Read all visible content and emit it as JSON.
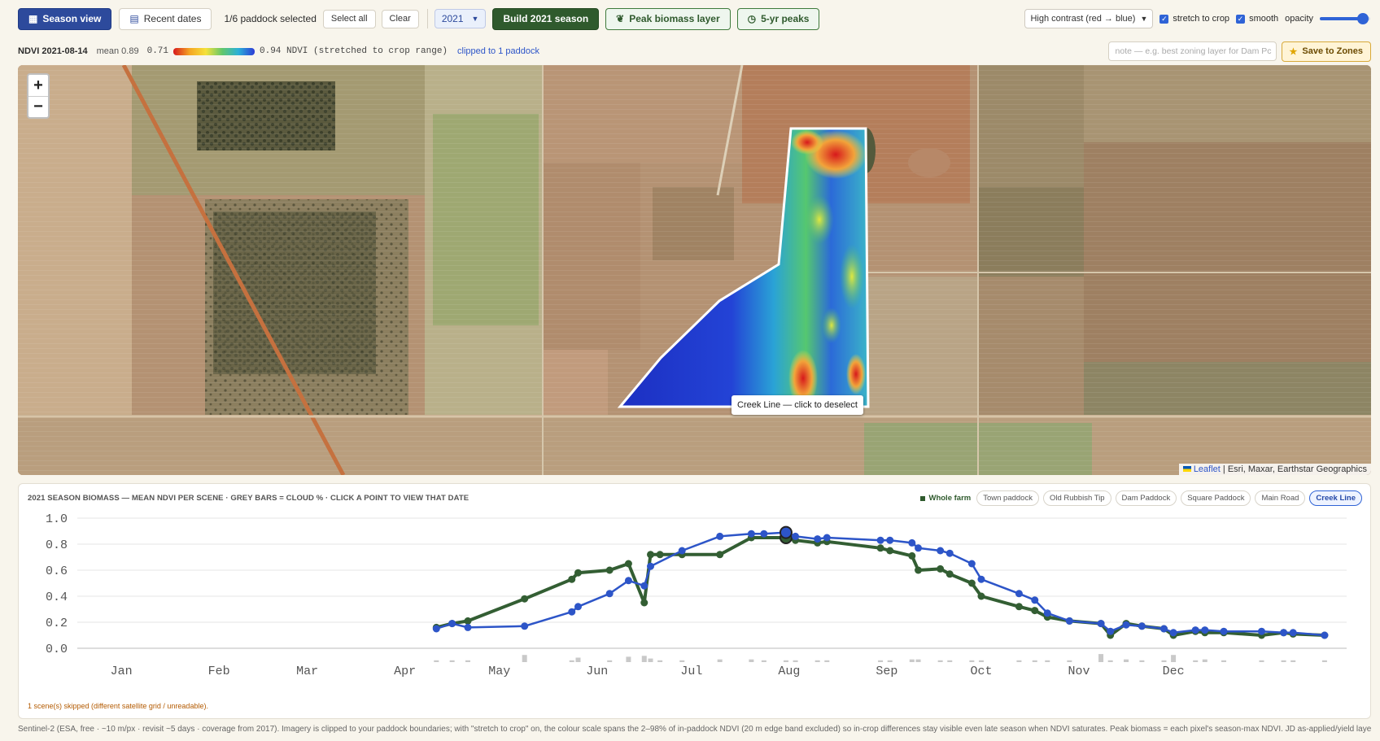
{
  "toolbar": {
    "season_view": "Season view",
    "recent_dates": "Recent dates",
    "paddock_selected": "1/6 paddock selected",
    "select_all": "Select all",
    "clear": "Clear",
    "year": "2021",
    "build_season": "Build 2021 season",
    "peak_biomass": "Peak biomass layer",
    "five_yr_peaks": "5-yr peaks",
    "palette": "High contrast (red → blue)",
    "stretch_label": "stretch to crop",
    "smooth_label": "smooth",
    "opacity_label": "opacity",
    "opacity_value": 0.85
  },
  "info": {
    "date": "NDVI 2021-08-14",
    "mean": "mean 0.89",
    "scale_min": "0.71",
    "scale_max": "0.94 NDVI (stretched to crop range)",
    "clipped": "clipped to 1 paddock",
    "note_placeholder": "note — e.g. best zoning layer for Dam Pc",
    "save_zones": "Save to Zones"
  },
  "map": {
    "tooltip": "Creek Line — click to deselect",
    "attribution_leaflet": "Leaflet",
    "attribution_rest": " | Esri, Maxar, Earthstar Geographics"
  },
  "chart_panel": {
    "title": "2021 SEASON BIOMASS — MEAN NDVI PER SCENE · GREY BARS = CLOUD % · CLICK A POINT TO VIEW THAT DATE",
    "legend": [
      "Whole farm",
      "Town paddock",
      "Old Rubbish Tip",
      "Dam Paddock",
      "Square Paddock",
      "Main Road",
      "Creek Line"
    ],
    "skipped": "1 scene(s) skipped (different satellite grid / unreadable)."
  },
  "chart_data": {
    "type": "line",
    "title": "2021 SEASON BIOMASS — MEAN NDVI PER SCENE",
    "xlabel": "",
    "ylabel": "",
    "ylim": [
      0,
      1.0
    ],
    "yticks": [
      "0.0",
      "0.2",
      "0.4",
      "0.6",
      "0.8",
      "1.0"
    ],
    "xticks": [
      "Jan",
      "Feb",
      "Mar",
      "Apr",
      "May",
      "Jun",
      "Jul",
      "Aug",
      "Sep",
      "Oct",
      "Nov",
      "Dec"
    ],
    "series": [
      {
        "name": "Whole farm",
        "color": "#335e33",
        "points": [
          [
            "2021-04-25",
            0.16
          ],
          [
            "2021-04-30",
            0.19
          ],
          [
            "2021-05-05",
            0.21
          ],
          [
            "2021-05-23",
            0.38
          ],
          [
            "2021-06-07",
            0.53
          ],
          [
            "2021-06-09",
            0.58
          ],
          [
            "2021-06-19",
            0.6
          ],
          [
            "2021-06-25",
            0.65
          ],
          [
            "2021-06-30",
            0.35
          ],
          [
            "2021-07-02",
            0.72
          ],
          [
            "2021-07-05",
            0.72
          ],
          [
            "2021-07-12",
            0.72
          ],
          [
            "2021-07-24",
            0.72
          ],
          [
            "2021-08-03",
            0.85
          ],
          [
            "2021-08-14",
            0.85
          ],
          [
            "2021-08-17",
            0.83
          ],
          [
            "2021-08-24",
            0.81
          ],
          [
            "2021-08-27",
            0.82
          ],
          [
            "2021-09-13",
            0.77
          ],
          [
            "2021-09-16",
            0.75
          ],
          [
            "2021-09-23",
            0.71
          ],
          [
            "2021-09-25",
            0.6
          ],
          [
            "2021-10-02",
            0.61
          ],
          [
            "2021-10-05",
            0.57
          ],
          [
            "2021-10-12",
            0.5
          ],
          [
            "2021-10-15",
            0.4
          ],
          [
            "2021-10-27",
            0.32
          ],
          [
            "2021-11-01",
            0.29
          ],
          [
            "2021-11-05",
            0.24
          ],
          [
            "2021-11-12",
            0.21
          ],
          [
            "2021-11-22",
            0.19
          ],
          [
            "2021-11-25",
            0.1
          ],
          [
            "2021-11-30",
            0.19
          ],
          [
            "2021-12-05",
            0.17
          ],
          [
            "2021-12-12",
            0.15
          ],
          [
            "2021-12-15",
            0.1
          ],
          [
            "2021-12-22",
            0.13
          ],
          [
            "2021-12-25",
            0.12
          ],
          [
            "2021-12-31",
            0.12
          ],
          [
            "2022-01-12",
            0.1
          ],
          [
            "2022-01-19",
            0.12
          ],
          [
            "2022-01-22",
            0.11
          ],
          [
            "2022-02-01",
            0.1
          ]
        ]
      },
      {
        "name": "Creek Line",
        "color": "#2d55c8",
        "points": [
          [
            "2021-04-25",
            0.15
          ],
          [
            "2021-04-30",
            0.19
          ],
          [
            "2021-05-05",
            0.16
          ],
          [
            "2021-05-23",
            0.17
          ],
          [
            "2021-06-07",
            0.28
          ],
          [
            "2021-06-09",
            0.32
          ],
          [
            "2021-06-19",
            0.42
          ],
          [
            "2021-06-25",
            0.52
          ],
          [
            "2021-06-30",
            0.48
          ],
          [
            "2021-07-02",
            0.63
          ],
          [
            "2021-07-12",
            0.75
          ],
          [
            "2021-07-24",
            0.86
          ],
          [
            "2021-08-03",
            0.88
          ],
          [
            "2021-08-07",
            0.88
          ],
          [
            "2021-08-14",
            0.89
          ],
          [
            "2021-08-17",
            0.86
          ],
          [
            "2021-08-24",
            0.84
          ],
          [
            "2021-08-27",
            0.85
          ],
          [
            "2021-09-13",
            0.83
          ],
          [
            "2021-09-16",
            0.83
          ],
          [
            "2021-09-23",
            0.81
          ],
          [
            "2021-09-25",
            0.77
          ],
          [
            "2021-10-02",
            0.75
          ],
          [
            "2021-10-05",
            0.73
          ],
          [
            "2021-10-12",
            0.65
          ],
          [
            "2021-10-15",
            0.53
          ],
          [
            "2021-10-27",
            0.42
          ],
          [
            "2021-11-01",
            0.37
          ],
          [
            "2021-11-05",
            0.27
          ],
          [
            "2021-11-12",
            0.21
          ],
          [
            "2021-11-22",
            0.19
          ],
          [
            "2021-11-25",
            0.13
          ],
          [
            "2021-11-30",
            0.18
          ],
          [
            "2021-12-05",
            0.17
          ],
          [
            "2021-12-12",
            0.15
          ],
          [
            "2021-12-15",
            0.12
          ],
          [
            "2021-12-22",
            0.14
          ],
          [
            "2021-12-25",
            0.14
          ],
          [
            "2021-12-31",
            0.13
          ],
          [
            "2022-01-12",
            0.13
          ],
          [
            "2022-01-19",
            0.12
          ],
          [
            "2022-01-22",
            0.12
          ],
          [
            "2022-02-01",
            0.1
          ]
        ]
      }
    ],
    "selected_date": "2021-08-14",
    "cloud_bars": [
      [
        "2021-04-25",
        2
      ],
      [
        "2021-04-30",
        2
      ],
      [
        "2021-05-05",
        2
      ],
      [
        "2021-05-23",
        8
      ],
      [
        "2021-06-07",
        2
      ],
      [
        "2021-06-09",
        5
      ],
      [
        "2021-06-19",
        2
      ],
      [
        "2021-06-25",
        6
      ],
      [
        "2021-06-30",
        7
      ],
      [
        "2021-07-02",
        4
      ],
      [
        "2021-07-05",
        2
      ],
      [
        "2021-07-12",
        2
      ],
      [
        "2021-07-24",
        3
      ],
      [
        "2021-08-03",
        3
      ],
      [
        "2021-08-07",
        2
      ],
      [
        "2021-08-14",
        2
      ],
      [
        "2021-08-17",
        2
      ],
      [
        "2021-08-24",
        2
      ],
      [
        "2021-08-27",
        2
      ],
      [
        "2021-09-13",
        2
      ],
      [
        "2021-09-16",
        2
      ],
      [
        "2021-09-23",
        3
      ],
      [
        "2021-09-25",
        3
      ],
      [
        "2021-10-02",
        2
      ],
      [
        "2021-10-05",
        2
      ],
      [
        "2021-10-12",
        2
      ],
      [
        "2021-10-15",
        2
      ],
      [
        "2021-10-27",
        2
      ],
      [
        "2021-11-01",
        2
      ],
      [
        "2021-11-05",
        2
      ],
      [
        "2021-11-12",
        2
      ],
      [
        "2021-11-22",
        9
      ],
      [
        "2021-11-25",
        2
      ],
      [
        "2021-11-30",
        3
      ],
      [
        "2021-12-05",
        2
      ],
      [
        "2021-12-12",
        2
      ],
      [
        "2021-12-15",
        8
      ],
      [
        "2021-12-22",
        2
      ],
      [
        "2021-12-25",
        3
      ],
      [
        "2021-12-31",
        2
      ],
      [
        "2022-01-12",
        2
      ],
      [
        "2022-01-19",
        2
      ],
      [
        "2022-01-22",
        2
      ],
      [
        "2022-02-01",
        2
      ]
    ]
  },
  "footer": "Sentinel-2 (ESA, free · ~10 m/px · revisit ~5 days · coverage from 2017). Imagery is clipped to your paddock boundaries; with \"stretch to crop\" on, the colour scale spans the 2–98% of in-paddock NDVI (20 m edge band excluded) so in-crop differences stay visible even late season when NDVI saturates. Peak biomass = each pixel's season-max NDVI. JD as-applied/yield layers arrive"
}
